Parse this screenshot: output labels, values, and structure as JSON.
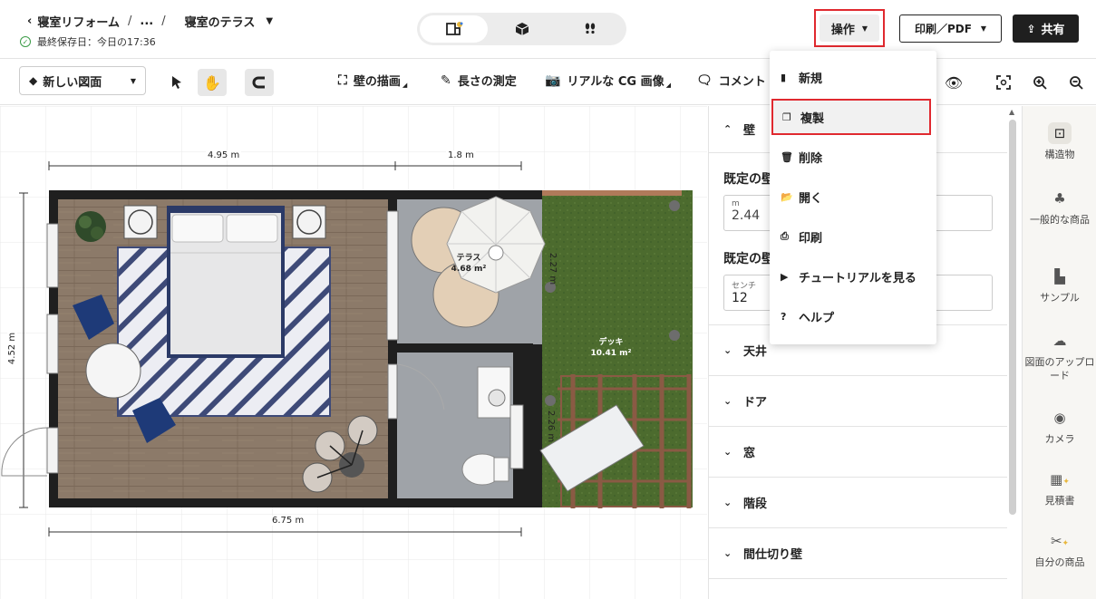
{
  "header": {
    "breadcrumb": [
      "寝室リフォーム",
      "...",
      "寝室のテラス"
    ],
    "saved_status": "最終保存日：今日の17:36",
    "view_modes": [
      "2d-plan-icon",
      "3d-box-icon",
      "walk-footprints-icon"
    ],
    "ops_label": "操作",
    "print_label": "印刷／PDF",
    "share_label": "共有"
  },
  "toolbar": {
    "new_plan_label": "新しい図面",
    "tools": [
      "壁の描画",
      "長さの測定",
      "リアルな CG 画像",
      "コメント"
    ]
  },
  "canvas": {
    "dims": {
      "top_left": "4.95 m",
      "top_right": "1.8 m",
      "left": "4.52 m",
      "bottom": "6.75 m",
      "wall_a": "2.27 m",
      "wall_b": "2.26 m"
    },
    "rooms": [
      {
        "name": "テラス",
        "area": "4.68 m²"
      },
      {
        "name": "デッキ",
        "area": "10.41 m²"
      }
    ]
  },
  "right_panel": {
    "wall_section": "壁",
    "default_height_title": "既定の壁",
    "height_unit": "m",
    "height_value": "2.44",
    "default_thickness_title": "既定の壁",
    "thickness_unit": "センチ",
    "thickness_value": "12",
    "sections": [
      "天井",
      "ドア",
      "窓",
      "階段",
      "間仕切り壁"
    ]
  },
  "right_sidebar": [
    {
      "label": "構造物",
      "icon": "structure-icon"
    },
    {
      "label": "一般的な商品",
      "icon": "products-icon"
    },
    {
      "label": "サンプル",
      "icon": "sample-icon"
    },
    {
      "label": "図面のアップロード",
      "icon": "upload-cloud-icon"
    },
    {
      "label": "カメラ",
      "icon": "camera-icon"
    },
    {
      "label": "見積書",
      "icon": "estimate-icon"
    },
    {
      "label": "自分の商品",
      "icon": "my-products-icon"
    }
  ],
  "ops_menu": {
    "items": [
      "新規",
      "複製",
      "削除",
      "開く",
      "印刷",
      "チュートリアルを見る",
      "ヘルプ"
    ],
    "highlighted": "複製"
  },
  "colors": {
    "highlight_red": "#e0292f",
    "wall": "#1f1f1f",
    "wood_floor": "#8c7a69",
    "tile_floor": "#9fa3a8",
    "grass": "#4c6b2e",
    "pergola": "#8a5a44"
  }
}
